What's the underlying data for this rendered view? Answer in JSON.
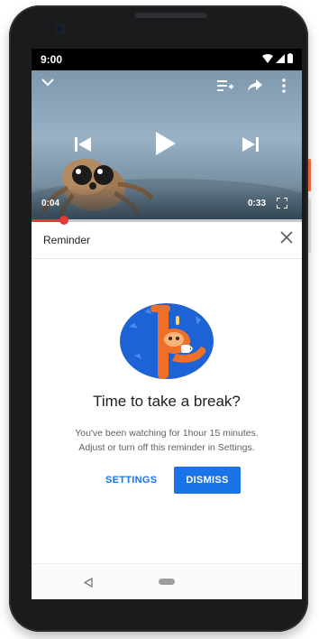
{
  "status_bar": {
    "time": "9:00"
  },
  "player": {
    "current_time": "0:04",
    "duration": "0:33",
    "progress_fraction": 0.12
  },
  "reminder": {
    "title": "Reminder",
    "headline": "Time to take a break?",
    "body_line1": "You've been watching for 1hour 15 minutes.",
    "body_line2": "Adjust or turn off this reminder in Settings.",
    "settings_label": "SETTINGS",
    "dismiss_label": "DISMISS"
  },
  "colors": {
    "accent": "#1a73e8",
    "progress": "#e53935",
    "illustration_bg": "#1e63d6",
    "illustration_character": "#f0702a"
  },
  "icons": [
    "collapse-chevron-icon",
    "add-to-queue-icon",
    "share-icon",
    "more-vert-icon",
    "previous-icon",
    "play-icon",
    "next-icon",
    "fullscreen-icon",
    "close-icon",
    "back-nav-icon",
    "home-nav-icon",
    "wifi-icon",
    "signal-icon",
    "battery-icon"
  ]
}
